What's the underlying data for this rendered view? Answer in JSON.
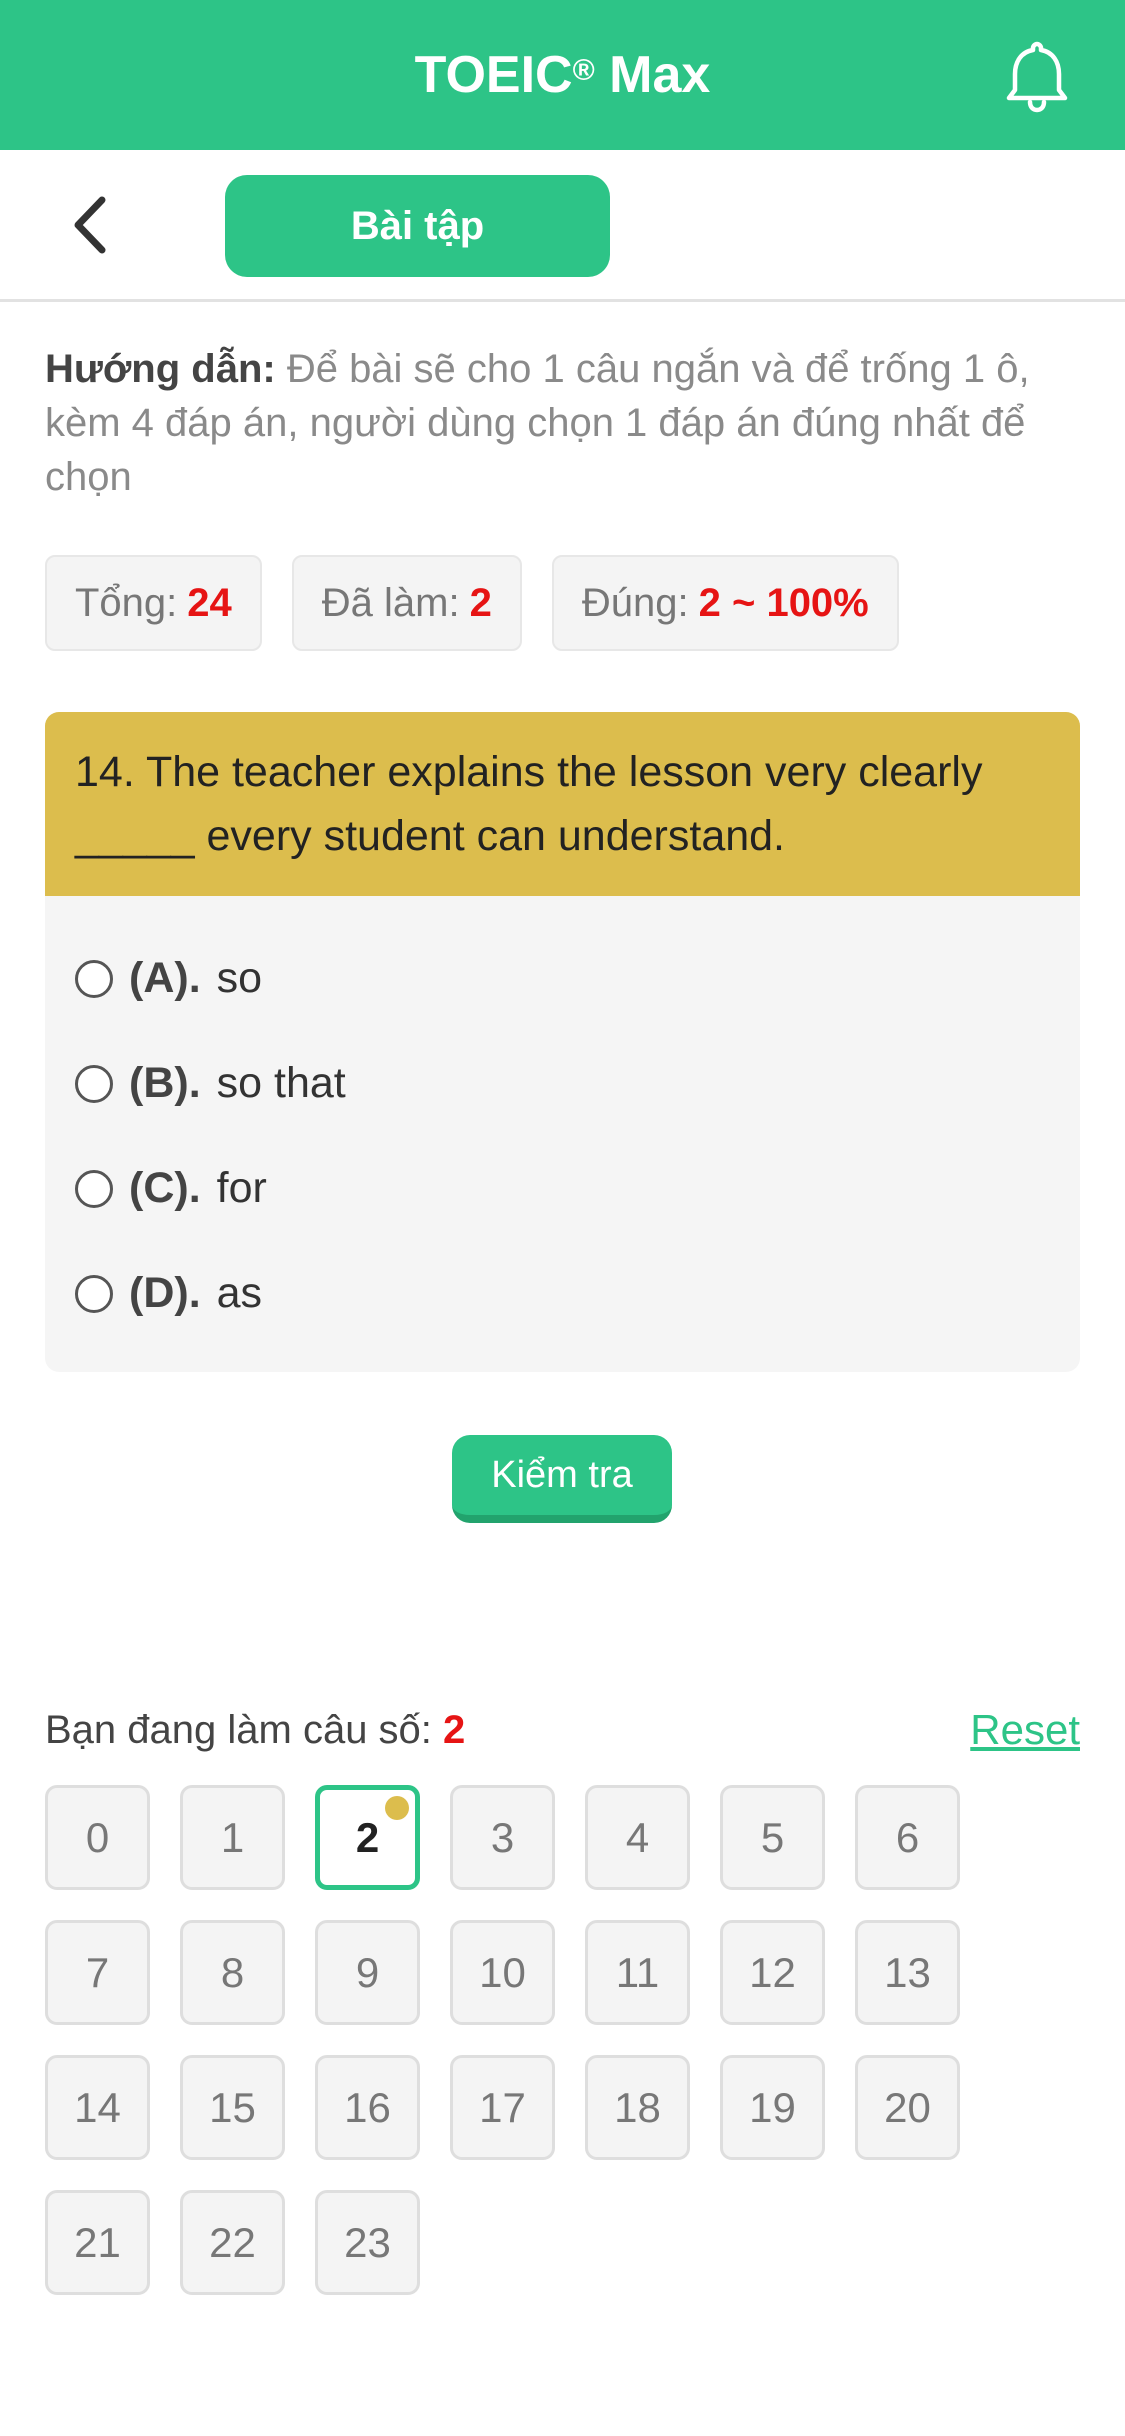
{
  "header": {
    "title": "TOEIC",
    "title_mark": "®",
    "title_suffix": " Max",
    "bell_icon": "bell-icon"
  },
  "subbar": {
    "back_icon": "chevron-left-icon",
    "tab_label": "Bài tập"
  },
  "guide": {
    "label": "Hướng dẫn:",
    "text": " Để bài sẽ cho 1 câu ngắn và để trống 1 ô, kèm 4 đáp án, người dùng chọn 1 đáp án đúng nhất để chọn"
  },
  "stats": {
    "total_label": "Tổng:",
    "total_value": "24",
    "done_label": "Đã làm:",
    "done_value": "2",
    "correct_label": "Đúng:",
    "correct_value": "2 ~ 100%"
  },
  "question": {
    "text": "14. The teacher explains the lesson very clearly _____ every student can understand.",
    "options": [
      {
        "letter": "(A).",
        "text": "so"
      },
      {
        "letter": "(B).",
        "text": "so that"
      },
      {
        "letter": "(C).",
        "text": "for"
      },
      {
        "letter": "(D).",
        "text": "as"
      }
    ]
  },
  "check_button": "Kiểm tra",
  "progress": {
    "label": "Bạn đang làm câu số: ",
    "current": "2",
    "reset_label": "Reset"
  },
  "grid": {
    "active_index": 2,
    "cells": [
      "0",
      "1",
      "2",
      "3",
      "4",
      "5",
      "6",
      "7",
      "8",
      "9",
      "10",
      "11",
      "12",
      "13",
      "14",
      "15",
      "16",
      "17",
      "18",
      "19",
      "20",
      "21",
      "22",
      "23"
    ]
  },
  "colors": {
    "brand": "#2dc487",
    "question_bg": "#dcbd4d",
    "number_red": "#e61414"
  }
}
